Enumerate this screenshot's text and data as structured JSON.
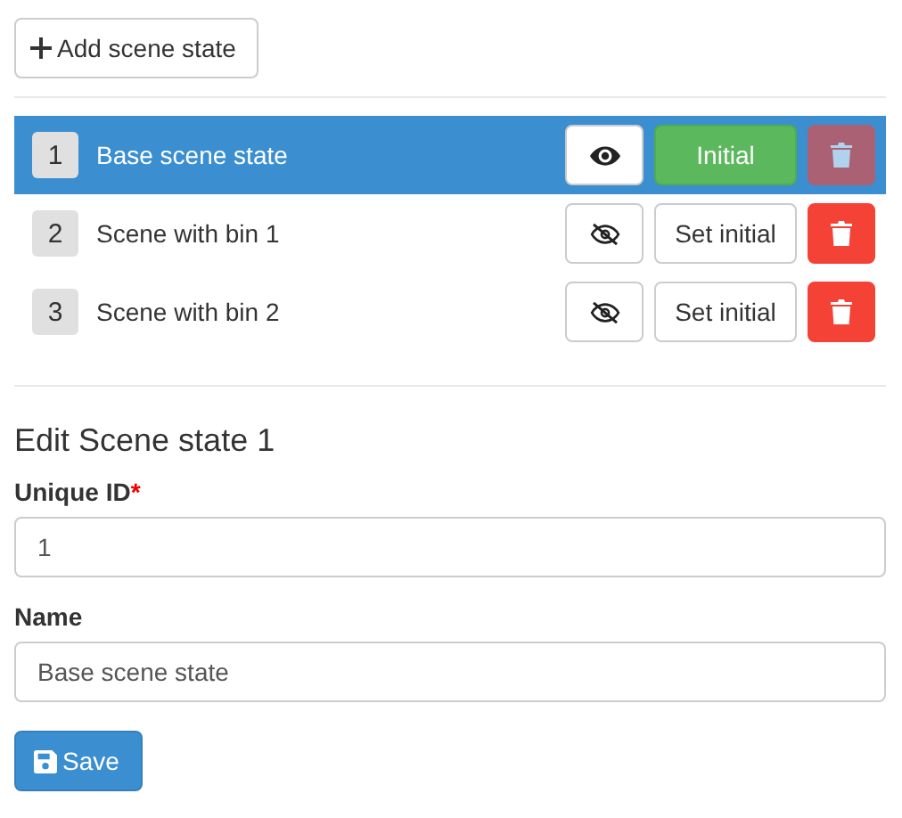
{
  "add_button": {
    "label": "Add scene state"
  },
  "scene_states": [
    {
      "number": "1",
      "name": "Base scene state",
      "selected": true,
      "visible": true,
      "initial": true,
      "initial_label": "Initial",
      "delete_disabled": true
    },
    {
      "number": "2",
      "name": "Scene with bin 1",
      "selected": false,
      "visible": false,
      "initial": false,
      "initial_label": "Set initial",
      "delete_disabled": false
    },
    {
      "number": "3",
      "name": "Scene with bin 2",
      "selected": false,
      "visible": false,
      "initial": false,
      "initial_label": "Set initial",
      "delete_disabled": false
    }
  ],
  "editor": {
    "title": "Edit Scene state 1",
    "fields": [
      {
        "label": "Unique ID",
        "required_mark": "*",
        "value": "1"
      },
      {
        "label": "Name",
        "value": "Base scene state"
      }
    ],
    "save_button": {
      "label": "Save"
    }
  }
}
